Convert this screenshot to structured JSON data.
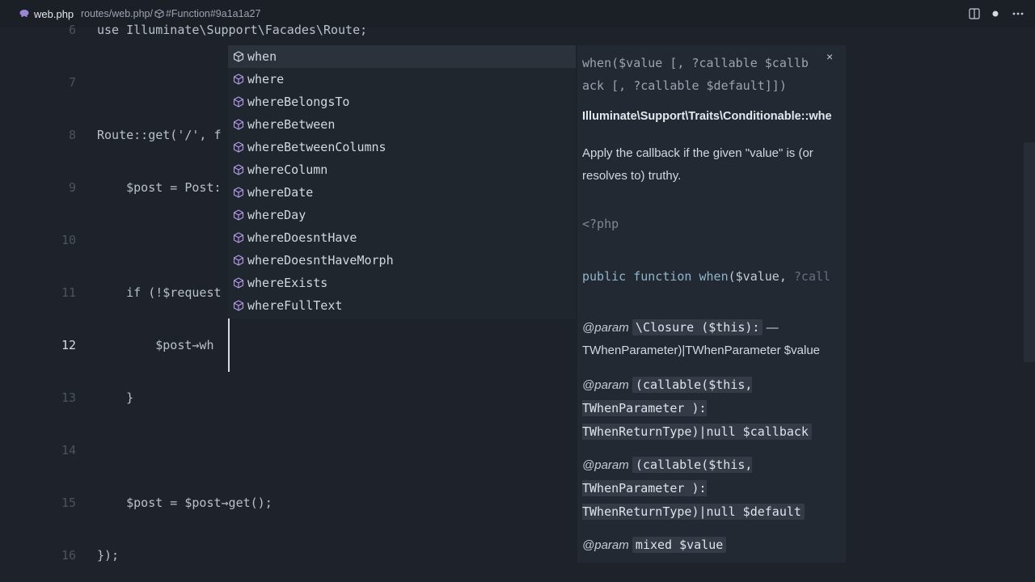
{
  "titlebar": {
    "file": "web.php",
    "path": "routes/web.php/",
    "symbol": "#Function#9a1a1a27"
  },
  "editor": {
    "lines": [
      {
        "num": "6",
        "code": "use Illuminate\\Support\\Facades\\Route;"
      },
      {
        "num": "7",
        "code": ""
      },
      {
        "num": "8",
        "code": "Route::get('/', f"
      },
      {
        "num": "9",
        "code": "    $post = Post:"
      },
      {
        "num": "10",
        "code": ""
      },
      {
        "num": "11",
        "code": "    if (!$request"
      },
      {
        "num": "12",
        "code": "        $post→wh"
      },
      {
        "num": "13",
        "code": "    }"
      },
      {
        "num": "14",
        "code": ""
      },
      {
        "num": "15",
        "code": "    $post = $post→get();"
      },
      {
        "num": "16",
        "code": "});"
      }
    ]
  },
  "suggestions": [
    {
      "label": "when",
      "selected": true
    },
    {
      "label": "where"
    },
    {
      "label": "whereBelongsTo"
    },
    {
      "label": "whereBetween"
    },
    {
      "label": "whereBetweenColumns"
    },
    {
      "label": "whereColumn"
    },
    {
      "label": "whereDate"
    },
    {
      "label": "whereDay"
    },
    {
      "label": "whereDoesntHave"
    },
    {
      "label": "whereDoesntHaveMorph"
    },
    {
      "label": "whereExists"
    },
    {
      "label": "whereFullText"
    }
  ],
  "docs": {
    "signature_1": "when($value [, ?callable $callb",
    "signature_2": "ack [, ?callable $default]])",
    "close": "×",
    "fqn": "Illuminate\\Support\\Traits\\Conditionable::whe",
    "description": "Apply the callback if the given \"value\" is (or resolves to) truthy.",
    "php_open": "<?php",
    "php_sig_kw": "public function",
    "php_sig_name": "when",
    "php_sig_rest": "($value, ",
    "php_sig_dim": "?call",
    "params": [
      {
        "at": "@param",
        "tag": "\\Closure ($this):",
        "rest": " — TWhenParameter)|TWhenParameter $value"
      },
      {
        "at": "@param",
        "tag": "(callable($this, TWhenParameter ): TWhenReturnType)|null $callback",
        "rest": ""
      },
      {
        "at": "@param",
        "tag": "(callable($this, TWhenParameter ): TWhenReturnType)|null $default",
        "rest": ""
      },
      {
        "at": "@param",
        "tag": "mixed $value",
        "rest": ""
      }
    ]
  }
}
